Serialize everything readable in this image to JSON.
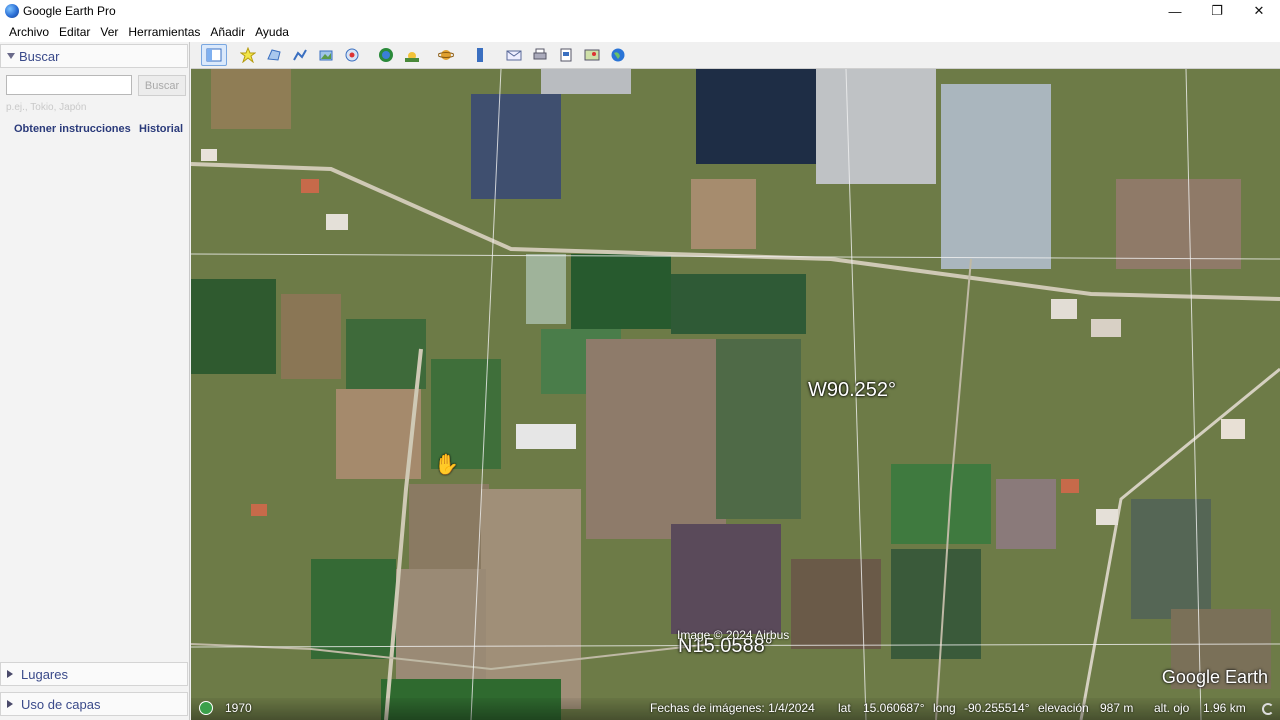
{
  "window": {
    "title": "Google Earth Pro",
    "controls": {
      "minimize": "—",
      "restore": "❐",
      "close": "✕"
    }
  },
  "menu": {
    "items": [
      "Archivo",
      "Editar",
      "Ver",
      "Herramientas",
      "Añadir",
      "Ayuda"
    ]
  },
  "sidebar": {
    "search_panel_label": "Buscar",
    "search_input_value": "",
    "search_button_label": "Buscar",
    "search_hint": "p.ej., Tokio, Japón",
    "directions_link": "Obtener instrucciones",
    "history_link": "Historial",
    "places_panel_label": "Lugares",
    "layers_panel_label": "Uso de capas"
  },
  "toolbar": {
    "icons": [
      "sidebar-toggle-icon",
      "placemark-icon",
      "polygon-icon",
      "path-icon",
      "image-overlay-icon",
      "record-tour-icon",
      "historical-imagery-icon",
      "sunlight-icon",
      "planets-icon",
      "ruler-icon",
      "email-icon",
      "print-icon",
      "save-image-icon",
      "view-in-maps-icon",
      "earth-icon"
    ]
  },
  "map": {
    "longitude_label": "W90.252°",
    "latitude_label": "N15.0588°",
    "image_credit": "Image © 2024 Airbus",
    "logo_text": "Google Earth",
    "status": {
      "timeline_year": "1970",
      "imagery_date": "Fechas de imágenes: 1/4/2024",
      "lat_label": "lat",
      "lat_value": "15.060687°",
      "long_label": "long",
      "long_value": "-90.255514°",
      "elevation_label": "elevación",
      "elevation_value": "987 m",
      "eye_alt_label": "alt. ojo",
      "eye_alt_value": "1.96 km"
    }
  },
  "colors": {
    "link_color": "#2a3a7a",
    "panel_label_color": "#3a4a8a",
    "map_base": "#6f8048"
  }
}
